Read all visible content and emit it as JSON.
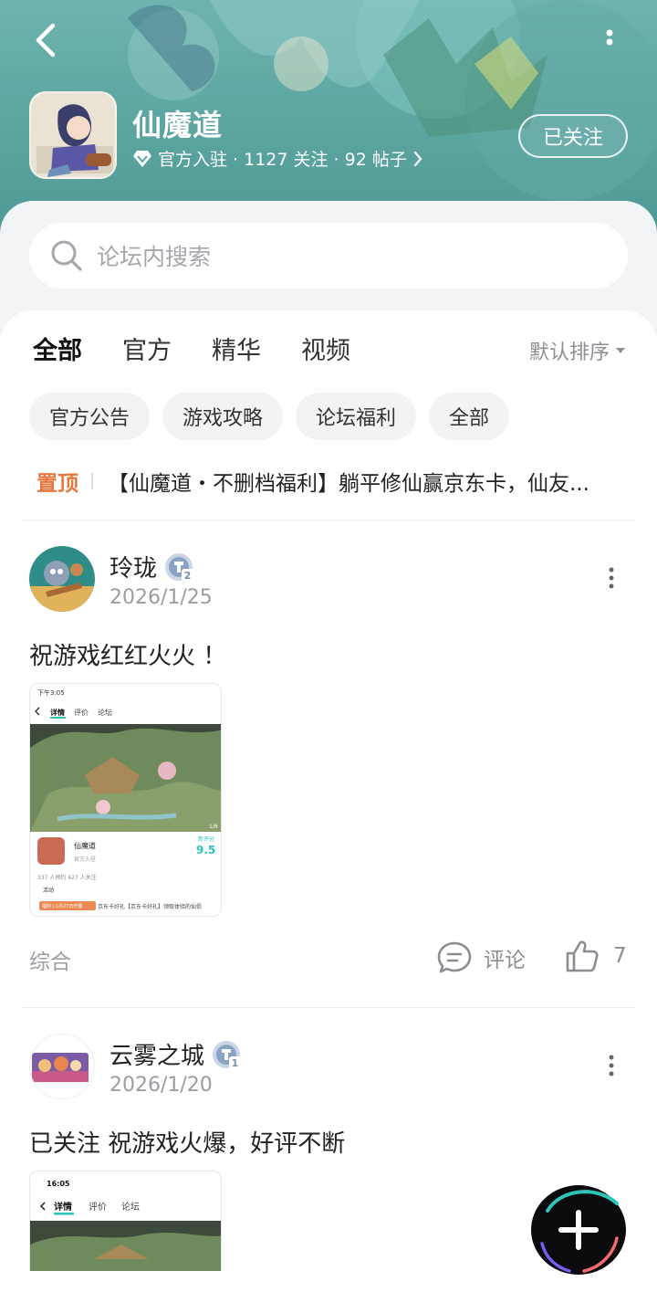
{
  "header": {
    "back_icon": "chevron-left-icon",
    "more_icon": "vertical-dots-icon",
    "app_name": "仙魔道",
    "meta_text": "官方入驻 · 1127 关注 · 92 帖子",
    "follow_label": "已关注"
  },
  "search": {
    "placeholder": "论坛内搜索"
  },
  "tabs": [
    {
      "label": "全部",
      "active": true
    },
    {
      "label": "官方"
    },
    {
      "label": "精华"
    },
    {
      "label": "视频"
    }
  ],
  "sort_label": "默认排序",
  "chips": [
    "官方公告",
    "游戏攻略",
    "论坛福利",
    "全部"
  ],
  "pinned": {
    "tag": "置顶",
    "text": "【仙魔道・不删档福利】躺平修仙赢京东卡，仙友..."
  },
  "posts": [
    {
      "user": "玲珑",
      "level": "2",
      "date": "2026/1/25",
      "text": "祝游戏红红火火 ！",
      "category": "综合",
      "comment_label": "评论",
      "likes": "7",
      "shot": {
        "status_time": "下午3:05",
        "tab_detail": "详情",
        "tab_review": "评价",
        "tab_forum": "论坛",
        "app_name": "仙魔道",
        "badge": "官方入驻",
        "score_label": "新评分",
        "score": "9.5",
        "stats": "337 人预约    427 人关注",
        "activity": "活动",
        "ad_tag": "福利 | 1月27日开服",
        "ad_text": "京东卡好礼【京东卡好礼】领取体验的仙侣",
        "page": "1/6"
      }
    },
    {
      "user": "云雾之城",
      "level": "1",
      "date": "2026/1/20",
      "text": "已关注 祝游戏火爆，好评不断",
      "shot": {
        "status_time": "16:05",
        "tab_detail": "详情",
        "tab_review": "评价",
        "tab_forum": "论坛"
      }
    }
  ],
  "fab_icon": "plus-icon"
}
